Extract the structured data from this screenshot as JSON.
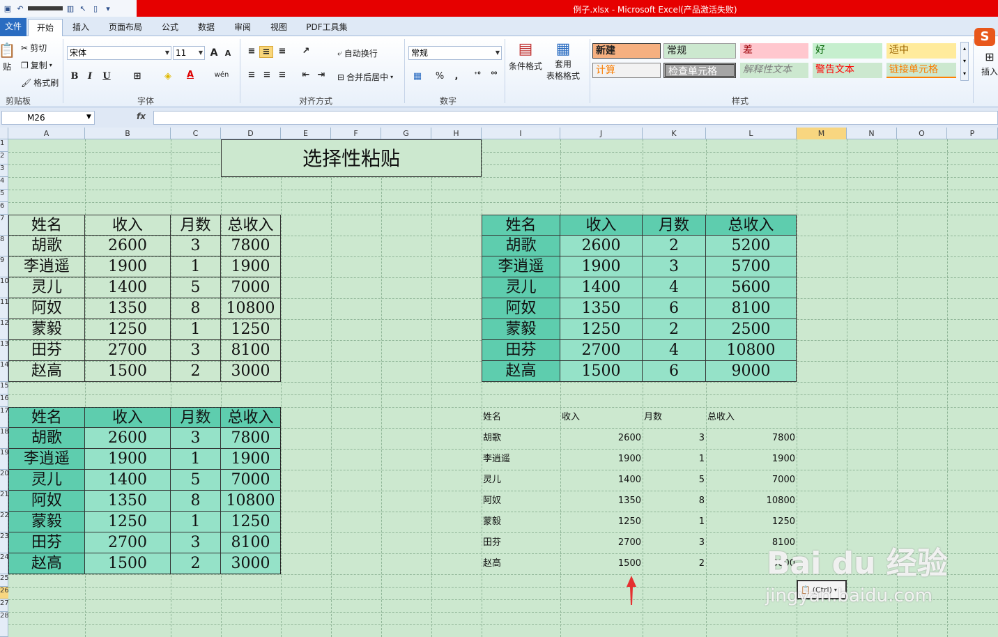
{
  "window": {
    "title": "例子.xlsx - Microsoft Excel(产品激活失败)"
  },
  "tabs": [
    "文件",
    "开始",
    "插入",
    "页面布局",
    "公式",
    "数据",
    "审阅",
    "视图",
    "PDF工具集"
  ],
  "ribbon": {
    "clipboard": {
      "paste": "贴",
      "cut": "剪切",
      "copy": "复制",
      "format_painter": "格式刷",
      "label": "剪贴板"
    },
    "font": {
      "name": "宋体",
      "size": "11",
      "label": "字体",
      "bold": "B",
      "italic": "I",
      "underline": "U",
      "grow": "A",
      "shrink": "A",
      "wen": "wén",
      "color_a": "A"
    },
    "alignment": {
      "wrap": "自动换行",
      "merge": "合并后居中",
      "label": "对齐方式"
    },
    "number": {
      "format": "常规",
      "percent": "%",
      "comma": ",",
      "label": "数字"
    },
    "cond_format": "条件格式",
    "table_format_1": "套用",
    "table_format_2": "表格格式",
    "styles": {
      "label": "样式",
      "cells": [
        "新建",
        "常规",
        "差",
        "好",
        "适中",
        "计算",
        "检查单元格",
        "解释性文本",
        "警告文本",
        "链接单元格"
      ]
    },
    "insert": "插入"
  },
  "formula_bar": {
    "name_box": "M26",
    "fx": "fx",
    "value": ""
  },
  "columns": [
    "A",
    "B",
    "C",
    "D",
    "E",
    "F",
    "G",
    "H",
    "I",
    "J",
    "K",
    "L",
    "M",
    "N",
    "O",
    "P"
  ],
  "selected_column": "M",
  "row_numbers": [
    "1",
    "2",
    "3",
    "4",
    "5",
    "6",
    "7",
    "8",
    "9",
    "10",
    "11",
    "12",
    "13",
    "14",
    "15",
    "16",
    "17",
    "18",
    "19",
    "20",
    "21",
    "22",
    "23",
    "24",
    "25",
    "26",
    "27",
    "28"
  ],
  "selected_row": "26",
  "sheet": {
    "title": "选择性粘贴",
    "headers": [
      "姓名",
      "收入",
      "月数",
      "总收入"
    ],
    "table_top_left": [
      [
        "胡歌",
        "2600",
        "3",
        "7800"
      ],
      [
        "李逍遥",
        "1900",
        "1",
        "1900"
      ],
      [
        "灵儿",
        "1400",
        "5",
        "7000"
      ],
      [
        "阿奴",
        "1350",
        "8",
        "10800"
      ],
      [
        "蒙毅",
        "1250",
        "1",
        "1250"
      ],
      [
        "田芬",
        "2700",
        "3",
        "8100"
      ],
      [
        "赵高",
        "1500",
        "2",
        "3000"
      ]
    ],
    "table_top_right": [
      [
        "胡歌",
        "2600",
        "2",
        "5200"
      ],
      [
        "李逍遥",
        "1900",
        "3",
        "5700"
      ],
      [
        "灵儿",
        "1400",
        "4",
        "5600"
      ],
      [
        "阿奴",
        "1350",
        "6",
        "8100"
      ],
      [
        "蒙毅",
        "1250",
        "2",
        "2500"
      ],
      [
        "田芬",
        "2700",
        "4",
        "10800"
      ],
      [
        "赵高",
        "1500",
        "6",
        "9000"
      ]
    ],
    "table_bottom_left": [
      [
        "胡歌",
        "2600",
        "3",
        "7800"
      ],
      [
        "李逍遥",
        "1900",
        "1",
        "1900"
      ],
      [
        "灵儿",
        "1400",
        "5",
        "7000"
      ],
      [
        "阿奴",
        "1350",
        "8",
        "10800"
      ],
      [
        "蒙毅",
        "1250",
        "1",
        "1250"
      ],
      [
        "田芬",
        "2700",
        "3",
        "8100"
      ],
      [
        "赵高",
        "1500",
        "2",
        "3000"
      ]
    ],
    "table_bottom_right": [
      [
        "胡歌",
        "2600",
        "3",
        "7800"
      ],
      [
        "李逍遥",
        "1900",
        "1",
        "1900"
      ],
      [
        "灵儿",
        "1400",
        "5",
        "7000"
      ],
      [
        "阿奴",
        "1350",
        "8",
        "10800"
      ],
      [
        "蒙毅",
        "1250",
        "1",
        "1250"
      ],
      [
        "田芬",
        "2700",
        "3",
        "8100"
      ],
      [
        "赵高",
        "1500",
        "2",
        "3000"
      ]
    ]
  },
  "paste_options": "(Ctrl)",
  "watermark": {
    "brand": "Bai du 经验",
    "url": "jingyan.baidu.com"
  },
  "colors": {
    "title_bar": "#e60000",
    "sheet_bg": "#cce8cf",
    "teal_header": "#5ecdae",
    "teal_body": "#95e2c8"
  }
}
